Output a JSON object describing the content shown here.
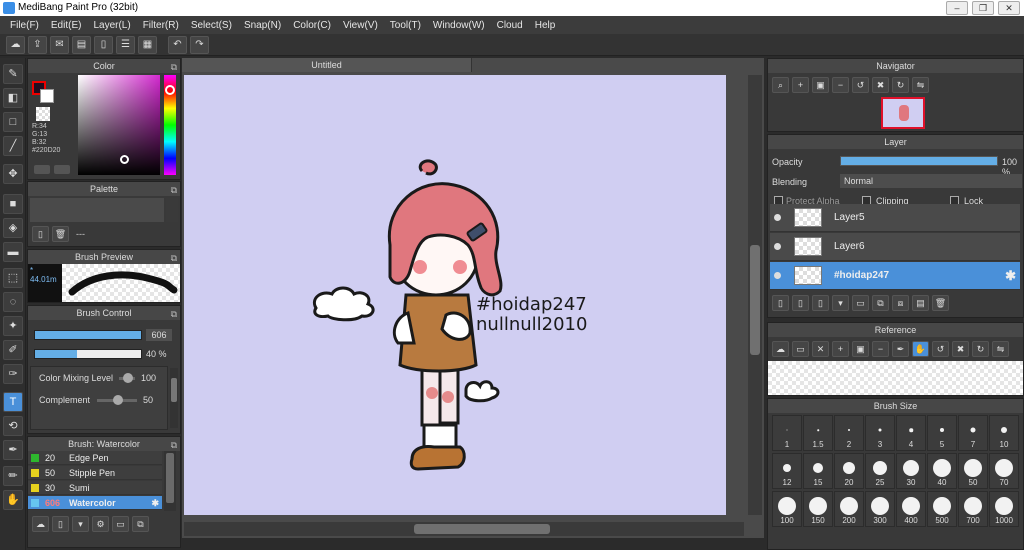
{
  "window": {
    "title": "MediBang Paint Pro (32bit)"
  },
  "menu": [
    "File(F)",
    "Edit(E)",
    "Layer(L)",
    "Filter(R)",
    "Select(S)",
    "Snap(N)",
    "Color(C)",
    "View(V)",
    "Tool(T)",
    "Window(W)",
    "Cloud",
    "Help"
  ],
  "document": {
    "tab_title": "Untitled"
  },
  "canvas_text": {
    "line1": "#hoidap247",
    "line2": "nullnull2010"
  },
  "color_panel": {
    "title": "Color",
    "r": "R:34",
    "g": "G:13",
    "b": "B:32",
    "hex": "#220D20",
    "foreground": "#220D20"
  },
  "palette_panel": {
    "title": "Palette",
    "dash": "---"
  },
  "brush_preview": {
    "title": "Brush Preview",
    "size": "* 44.01m"
  },
  "brush_control": {
    "title": "Brush Control",
    "size_value": "606",
    "size_fraction": 1.0,
    "opacity_value": "40 %",
    "opacity_fraction": 0.4,
    "color_mixing_label": "Color Mixing Level",
    "color_mixing_value": "100",
    "complement_label": "Complement",
    "complement_value": "50"
  },
  "brush_list": {
    "title": "Brush: Watercolor",
    "items": [
      {
        "num": "20",
        "name": "Edge Pen",
        "color": "#2eb82e"
      },
      {
        "num": "50",
        "name": "Stipple Pen",
        "color": "#e6d21e"
      },
      {
        "num": "30",
        "name": "Sumi",
        "color": "#e6d21e"
      },
      {
        "num": "606",
        "name": "Watercolor",
        "color": "#66c6f0"
      }
    ]
  },
  "navigator": {
    "title": "Navigator"
  },
  "layer_panel": {
    "title": "Layer",
    "opacity_label": "Opacity",
    "opacity_value": "100 %",
    "opacity_fraction": 1.0,
    "blending_label": "Blending",
    "blending_value": "Normal",
    "protect_alpha": "Protect Alpha",
    "clipping": "Clipping",
    "lock": "Lock",
    "layers": [
      {
        "name": "Layer5"
      },
      {
        "name": "Layer6"
      },
      {
        "name": "#hoidap247"
      }
    ]
  },
  "reference_panel": {
    "title": "Reference"
  },
  "brush_size_panel": {
    "title": "Brush Size",
    "sizes": [
      "1",
      "1.5",
      "2",
      "3",
      "4",
      "5",
      "7",
      "10",
      "12",
      "15",
      "20",
      "25",
      "30",
      "40",
      "50",
      "70",
      "100",
      "150",
      "200",
      "300",
      "400",
      "500",
      "700",
      "1000"
    ]
  },
  "icons": [
    "cloud-icon",
    "share-icon",
    "comment-icon",
    "undo-icon",
    "redo-icon",
    "brush-icon",
    "eraser-icon",
    "move-icon",
    "fill-icon",
    "text-icon",
    "hand-icon",
    "settings-icon"
  ]
}
